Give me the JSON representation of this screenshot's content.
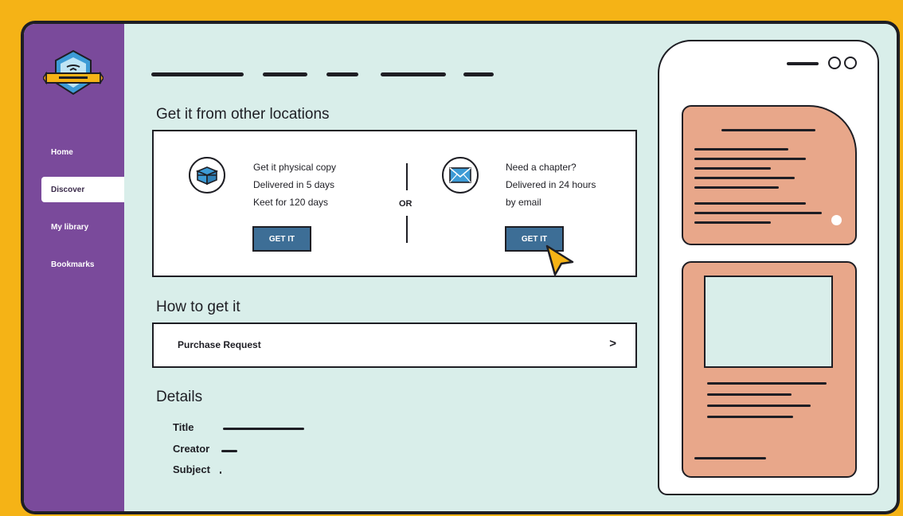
{
  "sidebar": {
    "items": [
      {
        "label": "Home"
      },
      {
        "label": "Discover"
      },
      {
        "label": "My library"
      },
      {
        "label": "Bookmarks"
      }
    ]
  },
  "locations": {
    "title": "Get it from other locations",
    "physical": {
      "line1": "Get it physical copy",
      "line2": "Delivered in 5 days",
      "line3": "Keet for 120 days",
      "button": "GET IT"
    },
    "or": "OR",
    "chapter": {
      "line1": "Need a chapter?",
      "line2": "Delivered in 24 hours",
      "line3": "by email",
      "button": "GET IT"
    }
  },
  "how": {
    "title": "How to get it",
    "option": "Purchase Request",
    "chevron": ">"
  },
  "details": {
    "title": "Details",
    "fields": [
      "Title",
      "Creator",
      "Subject"
    ]
  },
  "colors": {
    "background": "#f5b316",
    "sidebar": "#7a4a9b",
    "screen": "#d9eeea",
    "button": "#3d6e96",
    "phone_card": "#e8a78a"
  },
  "icons": [
    "library-logo-icon",
    "package-box-icon",
    "envelope-icon",
    "cursor-arrow-icon"
  ]
}
